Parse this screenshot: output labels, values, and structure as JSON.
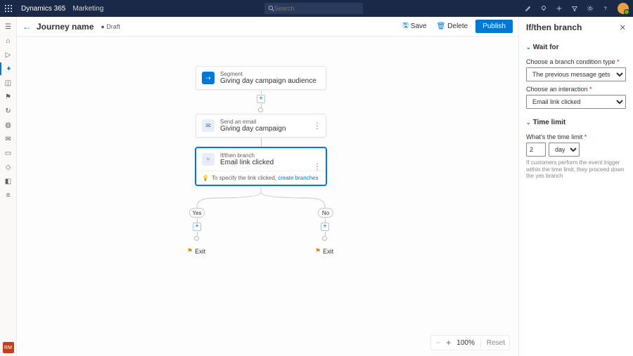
{
  "topbar": {
    "brand": "Dynamics 365",
    "area": "Marketing",
    "search_placeholder": "Search"
  },
  "cmdbar": {
    "title": "Journey name",
    "status": "● Draft",
    "save": "Save",
    "delete": "Delete",
    "publish": "Publish"
  },
  "leftrail_footer": "RM",
  "nodes": {
    "segment": {
      "type": "Segment",
      "title": "Giving day campaign audience"
    },
    "email": {
      "type": "Send an email",
      "title": "Giving day campaign"
    },
    "branch": {
      "type": "If/then branch",
      "title": "Email link clicked",
      "hint_prefix": "To specify the link clicked, ",
      "hint_link": "create branches"
    }
  },
  "branches": {
    "yes": "Yes",
    "no": "No",
    "exit": "Exit"
  },
  "zoom": {
    "level": "100%",
    "reset": "Reset"
  },
  "panel": {
    "title": "If/then branch",
    "section_wait": "Wait for",
    "cond_type_label": "Choose a branch condition type",
    "cond_type_value": "The previous message gets an interaction",
    "interaction_label": "Choose an interaction",
    "interaction_value": "Email link clicked",
    "section_time": "Time limit",
    "time_label": "What's the time limit",
    "time_value": "2",
    "time_unit": "days",
    "help": "If customers perform the event trigger within the time limit, they proceed down the yes branch"
  }
}
